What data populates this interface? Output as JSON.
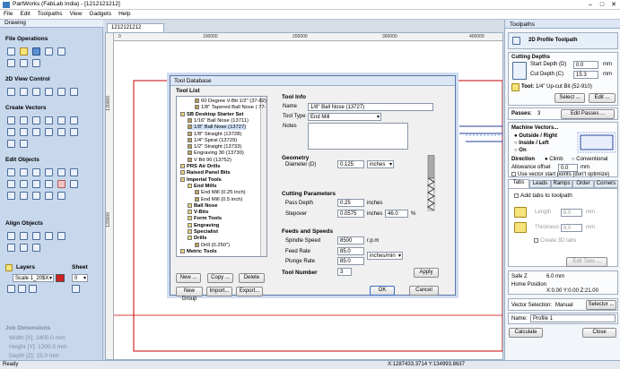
{
  "window": {
    "title": "PartWorks (FabLab India) - [1212121212]",
    "controls": [
      "–",
      "□",
      "✕"
    ]
  },
  "menu": [
    "File",
    "Edit",
    "Toolpaths",
    "View",
    "Gadgets",
    "Help"
  ],
  "left_panel": {
    "title": "Drawing",
    "sections": {
      "file_ops": "File Operations",
      "view_control": "2D View Control",
      "create_vectors": "Create Vectors",
      "edit_objects": "Edit Objects",
      "align_objects": "Align Objects"
    },
    "layers_label": "Layers",
    "sheet_label": "Sheet",
    "layer_value": "Scale 1_20$X",
    "sheet_value": "0",
    "job_dimensions": {
      "title": "Job Dimensions",
      "width": "Width  [X]: 2400.0 mm",
      "height": "Height [Y]: 1200.0 mm",
      "depth": "Depth  [Z]: 15.0 mm"
    }
  },
  "document_tab": "1212121212",
  "rulers": {
    "h": [
      "0",
      "100000",
      "200000",
      "300000",
      "400000"
    ],
    "v": [
      "130000",
      "120000"
    ]
  },
  "dialog": {
    "title": "Tool Database",
    "tool_list_label": "Tool List",
    "tree": [
      {
        "label": "60 Degree V-Bit 1/2\" (37-82)",
        "indent": 2,
        "bold": false
      },
      {
        "label": "1/8\" Tapered Ball Nose ( 77-10",
        "indent": 2,
        "bold": false
      },
      {
        "label": "SB Desktop Starter Set",
        "indent": 0,
        "bold": true
      },
      {
        "label": "1/16\" Ball Nose (13711)",
        "indent": 1,
        "bold": false
      },
      {
        "label": "1/8\" Ball Nose (13727)",
        "indent": 1,
        "bold": false
      },
      {
        "label": "1/8\" Straight (13728)",
        "indent": 1,
        "bold": false
      },
      {
        "label": "1/4\" Spiral (13729)",
        "indent": 1,
        "bold": false
      },
      {
        "label": "1/2\" Straight (13733)",
        "indent": 1,
        "bold": false
      },
      {
        "label": "Engraving 30 (13730)",
        "indent": 1,
        "bold": false
      },
      {
        "label": "V Bit 90 (13752)",
        "indent": 1,
        "bold": false
      },
      {
        "label": "PRS Air Drills",
        "indent": 0,
        "bold": true
      },
      {
        "label": "Raised Panel Bits",
        "indent": 0,
        "bold": true
      },
      {
        "label": "Imperial Tools",
        "indent": 0,
        "bold": true
      },
      {
        "label": "End Mills",
        "indent": 1,
        "bold": true
      },
      {
        "label": "End Mill (0.25 inch)",
        "indent": 2,
        "bold": false
      },
      {
        "label": "End Mill (0.5 inch)",
        "indent": 2,
        "bold": false
      },
      {
        "label": "Ball Nose",
        "indent": 1,
        "bold": true
      },
      {
        "label": "V-Bits",
        "indent": 1,
        "bold": true
      },
      {
        "label": "Form Tools",
        "indent": 1,
        "bold": true
      },
      {
        "label": "Engraving",
        "indent": 1,
        "bold": true
      },
      {
        "label": "Specialist",
        "indent": 1,
        "bold": true
      },
      {
        "label": "Drills",
        "indent": 1,
        "bold": true
      },
      {
        "label": "Drill (0.250\")",
        "indent": 2,
        "bold": false
      },
      {
        "label": "Metric Tools",
        "indent": 0,
        "bold": true
      }
    ],
    "buttons": {
      "new": "New ...",
      "copy": "Copy ...",
      "delete": "Delete",
      "new_group": "New Group",
      "import": "Import...",
      "export": "Export...",
      "apply": "Apply",
      "ok": "OK",
      "cancel": "Cancel"
    },
    "tool_info": {
      "heading": "Tool Info",
      "name_label": "Name",
      "name_value": "1/8\" Ball Nose (13727)",
      "type_label": "Tool Type",
      "type_value": "End Mill",
      "notes_label": "Notes"
    },
    "geometry": {
      "heading": "Geometry",
      "diameter_label": "Diameter (D)",
      "diameter_value": "0.125",
      "diameter_unit": "inches"
    },
    "cutting": {
      "heading": "Cutting Parameters",
      "pass_label": "Pass Depth",
      "pass_value": "0.25",
      "pass_unit": "inches",
      "stepover_label": "Stepover",
      "stepover_value": "0.0575",
      "stepover_unit": "inches",
      "stepover_pct": "46.0",
      "pct_sign": "%"
    },
    "feeds": {
      "heading": "Feeds and Speeds",
      "spindle_label": "Spindle Speed",
      "spindle_value": "8500",
      "spindle_unit": "r.p.m",
      "feed_label": "Feed Rate",
      "feed_value": "85.0",
      "feed_unit": "inches/min",
      "plunge_label": "Plunge Rate",
      "plunge_value": "85.0"
    },
    "tool_number_label": "Tool Number",
    "tool_number_value": "3"
  },
  "right_panel": {
    "title": "Toolpaths",
    "toolpath_title": "2D Profile Toolpath",
    "cutting_depths": "Cutting Depths",
    "start_depth_label": "Start Depth (D)",
    "start_depth_value": "0.0",
    "start_unit": "mm",
    "cut_depth_label": "Cut Depth (C)",
    "cut_depth_value": "15.3",
    "cut_unit": "mm",
    "tool_label": "Tool:",
    "tool_value": "1/4\" Up-cut Bit (52-910)",
    "select_btn": "Select ...",
    "edit_btn": "Edit ...",
    "passes_label": "Passes:",
    "passes_value": "3",
    "edit_passes_btn": "Edit Passes ...",
    "machine_vectors": "Machine Vectors...",
    "opt_outside": "Outside / Right",
    "opt_inside": "Inside / Left",
    "opt_on": "On",
    "direction_label": "Direction",
    "dir_climb": "Climb",
    "dir_conventional": "Conventional",
    "allowance_label": "Allowance offset",
    "allowance_value": "0.0",
    "allowance_unit": "mm",
    "vector_start": "Use vector start points (don't optimize)",
    "tabs": [
      "Tabs",
      "Leads",
      "Ramps",
      "Order",
      "Corners"
    ],
    "add_tabs": "Add tabs to toolpath",
    "length_label": "Length",
    "length_value": "8.0",
    "length_unit": "mm",
    "thickness_label": "Thickness",
    "thickness_value": "8.0",
    "thickness_unit": "mm",
    "create_3d": "Create 3D tabs",
    "edit_tabs_btn": "Edit Tabs ...",
    "safe_z": "Safe Z",
    "safe_z_value": "6.0 mm",
    "home_label": "Home Position",
    "home_value": "X:0.00 Y:0.00 Z:21.00",
    "vector_sel_label": "Vector Selection:",
    "vector_sel_value": "Manual",
    "selector_btn": "Selector ...",
    "name_label": "Name:",
    "name_value": "Profile 1",
    "calculate_btn": "Calculate",
    "close_btn": "Close"
  },
  "status": {
    "left": "Ready",
    "coords": "X:1287433.3714 Y:134993.8637"
  },
  "colors": {
    "accent": "#3b7bbf",
    "panel": "#c7d8ec",
    "red_line": "#cc0000"
  }
}
